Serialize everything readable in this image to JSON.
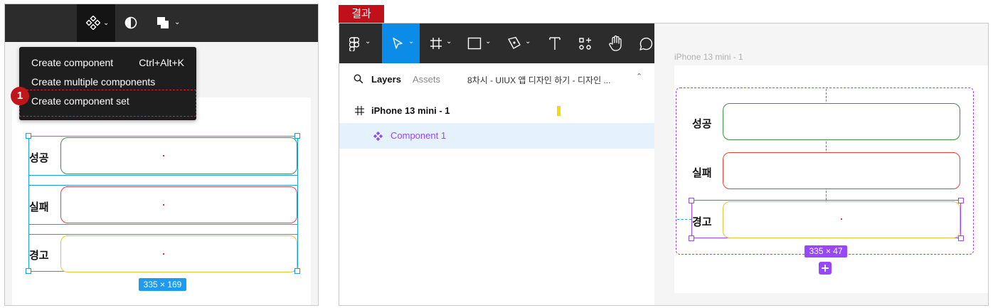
{
  "left_panel": {
    "toolbar_icons": [
      "component-icon",
      "contrast-icon",
      "boolean-icon"
    ],
    "menu": {
      "items": [
        {
          "label": "Create component",
          "shortcut": "Ctrl+Alt+K"
        },
        {
          "label": "Create multiple components",
          "shortcut": ""
        },
        {
          "label": "Create component set",
          "shortcut": ""
        }
      ],
      "highlighted_index": 2
    },
    "step_badge": "1",
    "rows": [
      {
        "label": "성공",
        "color": "#3b8f4c"
      },
      {
        "label": "실패",
        "color": "#e0403a"
      },
      {
        "label": "경고",
        "color": "#e7c33b"
      }
    ],
    "selection_size": "335 × 169",
    "selection_color": "#1e9bf0"
  },
  "result_label": "결과",
  "right_panel": {
    "tabs": {
      "layers": "Layers",
      "assets": "Assets",
      "file_name": "8차시 - UIUX 앱 디자인 하기 - 디자인 ..."
    },
    "layers": [
      {
        "name": "iPhone 13 mini - 1",
        "icon": "frame-icon",
        "selected": false
      },
      {
        "name": "Component 1",
        "icon": "component-icon",
        "selected": true
      }
    ],
    "canvas_frame_label": "iPhone 13 mini - 1",
    "rows": [
      {
        "label": "성공",
        "color": "#3b8f4c"
      },
      {
        "label": "실패",
        "color": "#e0403a"
      },
      {
        "label": "경고",
        "color": "#e7c33b"
      }
    ],
    "selection_size": "335 × 47",
    "component_color": "#9747ff",
    "toolbar_active_color": "#0c8ce9"
  }
}
